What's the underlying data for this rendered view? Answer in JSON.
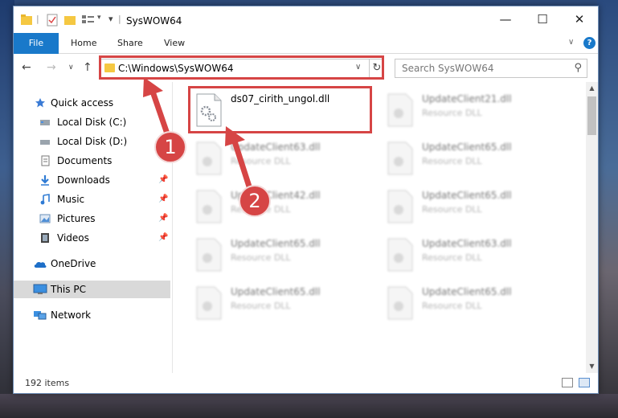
{
  "window": {
    "title": "SysWOW64"
  },
  "ribbon": {
    "tabs": [
      "File",
      "Home",
      "Share",
      "View"
    ]
  },
  "address": {
    "path": "C:\\Windows\\SysWOW64"
  },
  "search": {
    "placeholder": "Search SysWOW64"
  },
  "sidebar": {
    "items": [
      {
        "label": "Quick access",
        "icon": "star-icon",
        "pinned": false
      },
      {
        "label": "Local Disk (C:)",
        "icon": "drive-icon",
        "pinned": false
      },
      {
        "label": "Local Disk (D:)",
        "icon": "drive-icon",
        "pinned": false
      },
      {
        "label": "Documents",
        "icon": "documents-icon",
        "pinned": false
      },
      {
        "label": "Downloads",
        "icon": "download-icon",
        "pinned": true
      },
      {
        "label": "Music",
        "icon": "music-icon",
        "pinned": true
      },
      {
        "label": "Pictures",
        "icon": "pictures-icon",
        "pinned": true
      },
      {
        "label": "Videos",
        "icon": "video-icon",
        "pinned": true
      },
      {
        "label": "OneDrive",
        "icon": "cloud-icon",
        "pinned": false
      },
      {
        "label": "This PC",
        "icon": "computer-icon",
        "pinned": false,
        "selected": true
      },
      {
        "label": "Network",
        "icon": "network-icon",
        "pinned": false
      }
    ]
  },
  "files": [
    {
      "name": "ds07_cirith_ungol.dll",
      "type": "",
      "highlighted": true
    },
    {
      "name": "UpdateClient21.dll",
      "type": "Resource DLL"
    },
    {
      "name": "UpdateClient63.dll",
      "type": "Resource DLL"
    },
    {
      "name": "UpdateClient65.dll",
      "type": "Resource DLL"
    },
    {
      "name": "UpdateClient42.dll",
      "type": "Resource DLL"
    },
    {
      "name": "UpdateClient65.dll",
      "type": "Resource DLL"
    },
    {
      "name": "UpdateClient65.dll",
      "type": "Resource DLL"
    },
    {
      "name": "UpdateClient63.dll",
      "type": "Resource DLL"
    },
    {
      "name": "UpdateClient65.dll",
      "type": "Resource DLL"
    },
    {
      "name": "UpdateClient65.dll",
      "type": "Resource DLL"
    }
  ],
  "status": {
    "item_count": "192 items"
  },
  "annotations": {
    "step1": "1",
    "step2": "2",
    "color": "#d64545"
  }
}
